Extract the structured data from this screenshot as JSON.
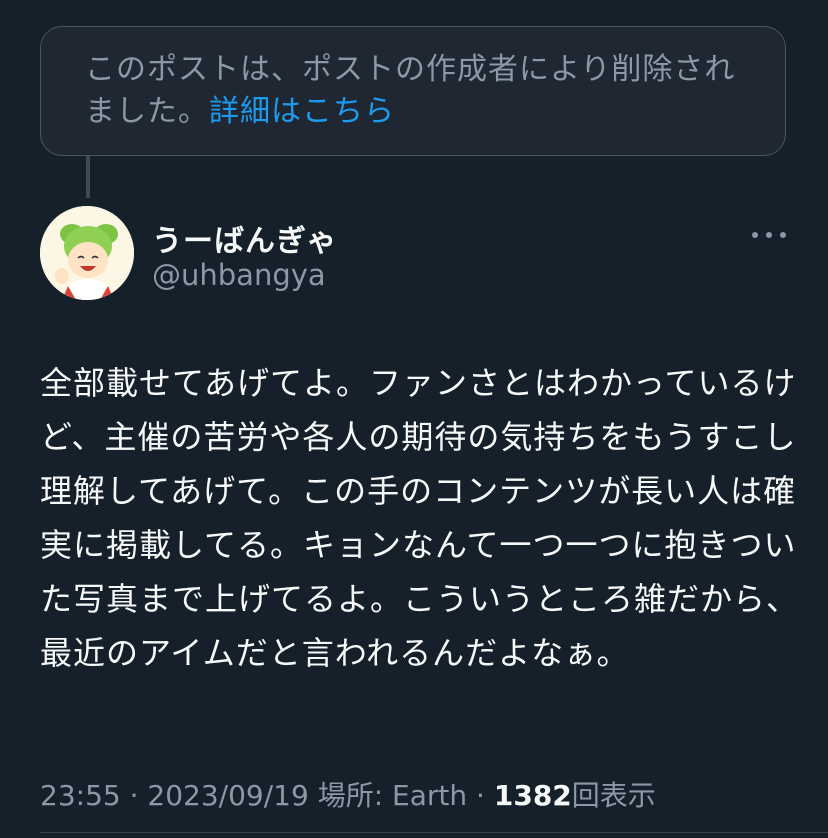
{
  "deleted_notice": {
    "text": "このポストは、ポストの作成者により削除されました。",
    "link_label": "詳細はこちら"
  },
  "author": {
    "display_name": "うーばんぎゃ",
    "handle": "@uhbangya",
    "avatar_icon": "avatar-icon"
  },
  "more_icon": "more-icon",
  "tweet": {
    "text": "全部載せてあげてよ。ファンさとはわかっているけど、主催の苦労や各人の期待の気持ちをもうすこし理解してあげて。この手のコンテンツが長い人は確実に掲載してる。キョンなんて一つ一つに抱きついた写真まで上げてるよ。こういうところ雑だから、最近のアイムだと言われるんだよなぁ。"
  },
  "meta": {
    "time": "23:55",
    "separator": "·",
    "date": "2023/09/19",
    "location": "場所: Earth",
    "view_count": "1382",
    "view_label": "回表示"
  },
  "colors": {
    "background": "#15202b",
    "text_primary": "#f7f9f9",
    "text_secondary": "#8b98a5",
    "link": "#1d9bf0"
  }
}
